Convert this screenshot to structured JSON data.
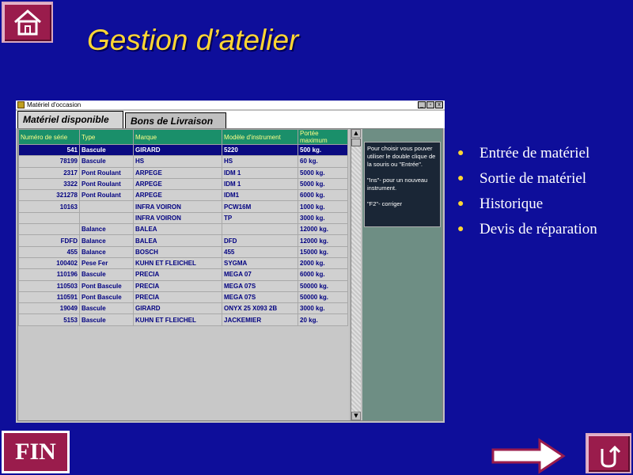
{
  "page": {
    "title": "Gestion d’atelier",
    "fin_label": "FIN",
    "icons": {
      "home": "home-icon",
      "next": "right-arrow-icon",
      "return": "u-turn-icon"
    }
  },
  "window": {
    "title": "Matériel d'occasion",
    "controls": [
      "_",
      "▫",
      "x"
    ],
    "tabs": [
      "Matériel disponible",
      "Bons de Livraison"
    ],
    "columns": [
      "Numéro de série",
      "Type",
      "Marque",
      "Modèle d'instrument",
      "Portée maximum"
    ],
    "rows": [
      [
        "541",
        "Bascule",
        "GIRARD",
        "5220",
        "500 kg."
      ],
      [
        "78199",
        "Bascule",
        "HS",
        "HS",
        "60 kg."
      ],
      [
        "2317",
        "Pont Roulant",
        "ARPEGE",
        "IDM 1",
        "5000 kg."
      ],
      [
        "3322",
        "Pont Roulant",
        "ARPEGE",
        "IDM 1",
        "5000 kg."
      ],
      [
        "321278",
        "Pont Roulant",
        "ARPEGE",
        "IDM1",
        "6000 kg."
      ],
      [
        "10163",
        "",
        "INFRA VOIRON",
        "PCW16M",
        "1000 kg."
      ],
      [
        "",
        "",
        "INFRA VOIRON",
        "TP",
        "3000 kg."
      ],
      [
        "",
        "Balance",
        "BALEA",
        "",
        "12000 kg."
      ],
      [
        "FDFD",
        "Balance",
        "BALEA",
        "DFD",
        "12000 kg."
      ],
      [
        "455",
        "Balance",
        "BOSCH",
        "455",
        "15000 kg."
      ],
      [
        "100402",
        "Pese Fer",
        "KUHN ET FLEICHEL",
        "SYGMA",
        "2000 kg."
      ],
      [
        "110196",
        "Bascule",
        "PRECIA",
        "MEGA 07",
        "6000 kg."
      ],
      [
        "110503",
        "Pont Bascule",
        "PRECIA",
        "MEGA 07S",
        "50000 kg."
      ],
      [
        "110591",
        "Pont Bascule",
        "PRECIA",
        "MEGA 07S",
        "50000 kg."
      ],
      [
        "19049",
        "Bascule",
        "GIRARD",
        "ONYX 25 X093 2B",
        "3000 kg."
      ],
      [
        "5153",
        "Bascule",
        "KUHN ET FLEICHEL",
        "JACKEMIER",
        "20 kg."
      ]
    ],
    "help": [
      "Pour choisir vous pouver utiliser le double clique de la souris ou \"Entrée\".",
      "\"Ins\"- pour un nouveau instrument.",
      "\"F2\"- corriger"
    ]
  },
  "menu": [
    "Entrée de matériel",
    "Sortie de matériel",
    "Historique",
    "Devis de réparation"
  ]
}
